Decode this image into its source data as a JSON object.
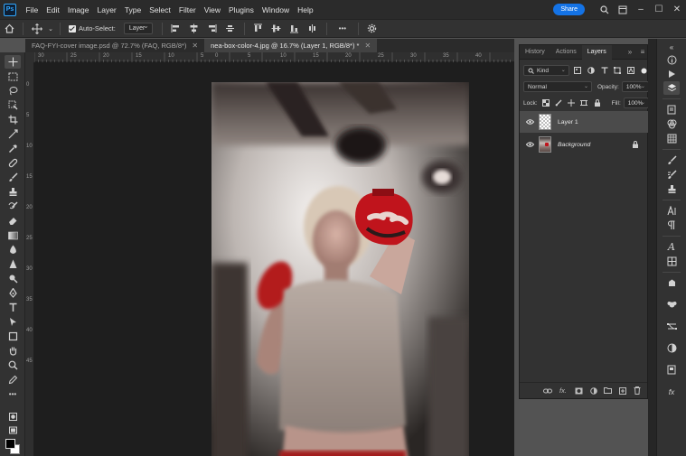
{
  "app": {
    "logo": "Ps"
  },
  "menu": [
    "File",
    "Edit",
    "Image",
    "Layer",
    "Type",
    "Select",
    "Filter",
    "View",
    "Plugins",
    "Window",
    "Help"
  ],
  "topbar": {
    "share_label": "Share",
    "icons": [
      "search-icon",
      "workspace-icon",
      "minimize-icon",
      "maximize-icon",
      "close-icon"
    ]
  },
  "options": {
    "auto_select_label": "Auto-Select:",
    "auto_select_checked": true,
    "auto_select_target": "Layer",
    "more_label": "•••"
  },
  "tabs": [
    {
      "label": "FAQ-FYI-cover image.psd @ 72.7% (FAQ, RGB/8*)",
      "active": false
    },
    {
      "label": "nea-box-color-4.jpg @ 16.7% (Layer 1, RGB/8*) *",
      "active": true
    }
  ],
  "rulers": {
    "horizontal": [
      "30",
      "25",
      "20",
      "15",
      "10",
      "5",
      "0",
      "5",
      "10",
      "15",
      "20",
      "25",
      "30",
      "35",
      "40"
    ],
    "vertical": [
      "0",
      "5",
      "10",
      "15",
      "20",
      "25",
      "30",
      "35",
      "40",
      "45"
    ]
  },
  "layers_panel": {
    "tabs": [
      "History",
      "Actions",
      "Layers"
    ],
    "active_tab": "Layers",
    "filter_kind": "Kind",
    "blend_mode": "Normal",
    "opacity_label": "Opacity:",
    "opacity_value": "100%",
    "lock_label": "Lock:",
    "fill_label": "Fill:",
    "fill_value": "100%",
    "layers": [
      {
        "name": "Layer 1",
        "selected": true,
        "locked": false,
        "italic": false
      },
      {
        "name": "Background",
        "selected": false,
        "locked": true,
        "italic": true
      }
    ],
    "footer_icons": [
      "link-layers-icon",
      "fx-icon",
      "add-mask-icon",
      "adjustment-layer-icon",
      "group-folder-icon",
      "new-layer-icon",
      "delete-layer-icon"
    ],
    "fx_label": "fx."
  },
  "colors": {
    "accent": "#1473e6",
    "foreground_swatch": "#000000",
    "background_swatch": "#ffffff",
    "glove": "#c0141c"
  }
}
